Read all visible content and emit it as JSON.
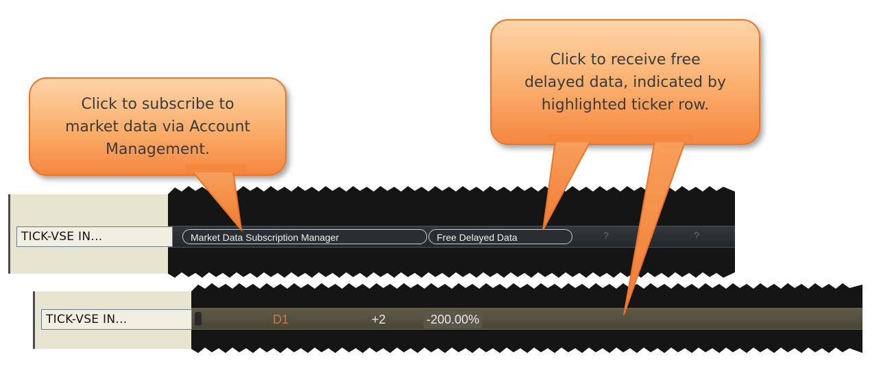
{
  "callouts": {
    "subscribe": {
      "lines": [
        "Click to subscribe to",
        "market data via Account",
        "Management."
      ]
    },
    "delayed": {
      "lines": [
        "Click to receive free",
        "delayed data, indicated by",
        "highlighted ticker row."
      ]
    }
  },
  "top_row": {
    "ticker": "TICK-VSE IN...",
    "subscription_button": "Market Data Subscription Manager",
    "delayed_button": "Free Delayed Data",
    "placeholder_1": "?",
    "placeholder_2": "?"
  },
  "bottom_row": {
    "ticker": "TICK-VSE IN...",
    "exchange": "D1",
    "change": "+2",
    "change_pct": "-200.00%"
  },
  "colors": {
    "callout_fill": "#fbb170",
    "callout_border": "#e8752a",
    "ticker_column": "#e7e5d0",
    "grid_background": "#151515",
    "highlight_row": "#5f5a48",
    "exchange_text": "#c9784b"
  }
}
